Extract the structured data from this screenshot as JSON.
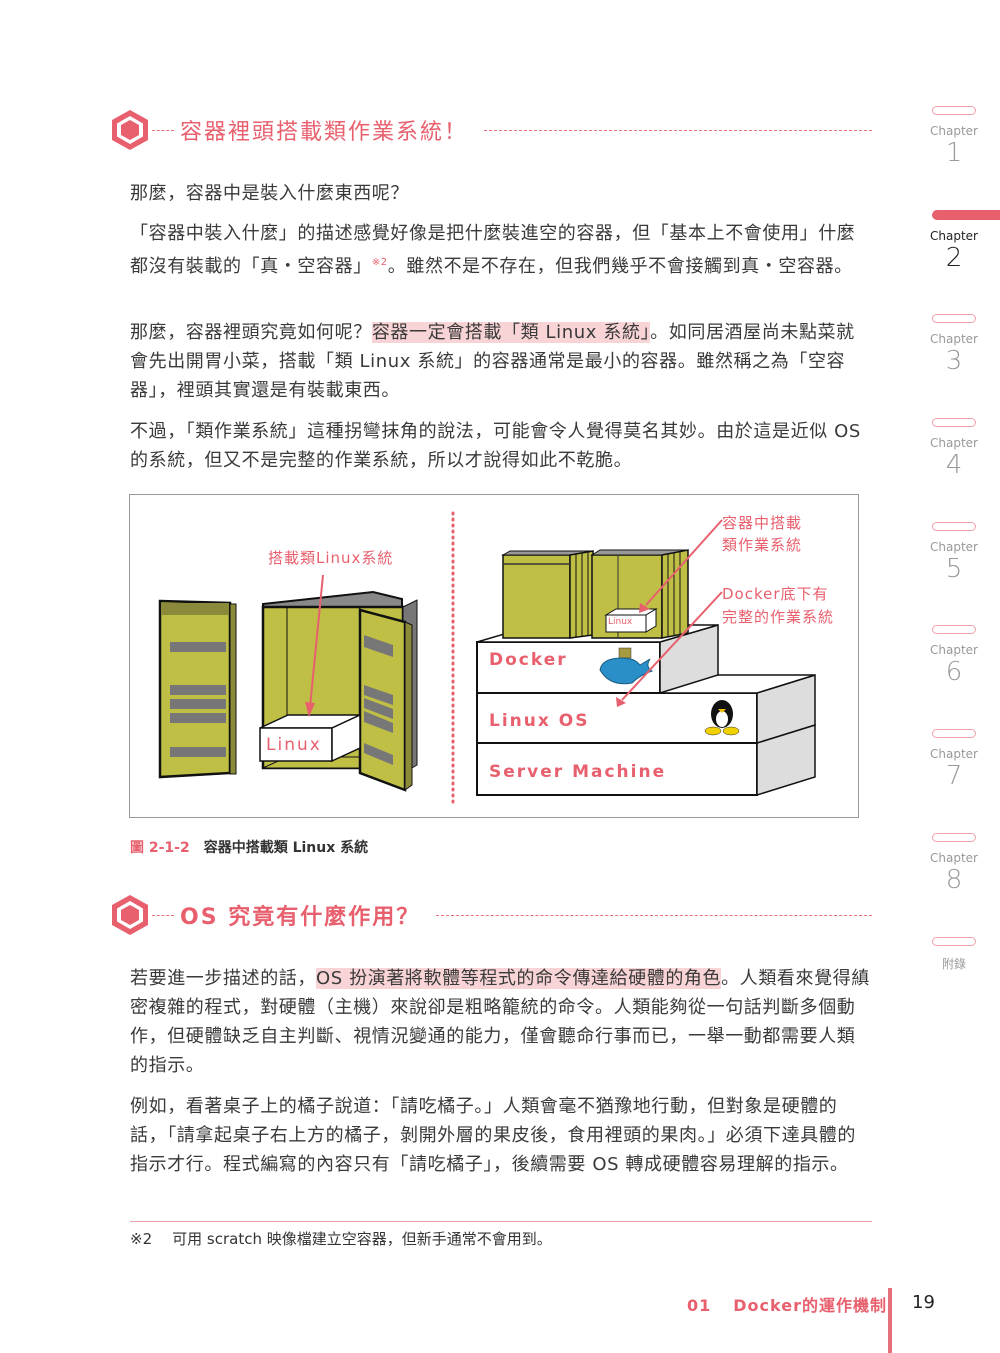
{
  "sections": [
    {
      "title": "容器裡頭搭載類作業系統！"
    },
    {
      "title": "OS 究竟有什麼作用？"
    }
  ],
  "paragraphs": {
    "p1": "那麼，容器中是裝入什麼東西呢？",
    "p2_a": "「容器中裝入什麼」的描述感覺好像是把什麼裝進空的容器，但「基本上不會使用」什麼都沒有裝載的「真・空容器」",
    "p2_sup": "※2",
    "p2_b": "。雖然不是不存在，但我們幾乎不會接觸到真・空容器。",
    "p3_a": "那麼，容器裡頭究竟如何呢？",
    "p3_hl": "容器一定會搭載「類 Linux 系統」",
    "p3_b": "。如同居酒屋尚未點菜就會先出開胃小菜，搭載「類 Linux 系統」的容器通常是最小的容器。雖然稱之為「空容器」，裡頭其實還是有裝載東西。",
    "p4": "不過，「類作業系統」這種拐彎抹角的說法，可能會令人覺得莫名其妙。由於這是近似 OS 的系統，但又不是完整的作業系統，所以才說得如此不乾脆。",
    "p5_a": "若要進一步描述的話，",
    "p5_hl": "OS 扮演著將軟體等程式的命令傳達給硬體的角色",
    "p5_b": "。人類看來覺得縝密複雜的程式，對硬體（主機）來說卻是粗略籠統的命令。人類能夠從一句話判斷多個動作，但硬體缺乏自主判斷、視情況變通的能力，僅會聽命行事而已，一舉一動都需要人類的指示。",
    "p6": "例如，看著桌子上的橘子說道：「請吃橘子。」人類會毫不猶豫地行動，但對象是硬體的話，「請拿起桌子右上方的橘子，剝開外層的果皮後，食用裡頭的果肉。」必須下達具體的指示才行。程式編寫的內容只有「請吃橘子」，後續需要 OS 轉成硬體容易理解的指示。"
  },
  "figure": {
    "left_label": "搭載類Linux系統",
    "left_box": "Linux",
    "right_box": "Linux",
    "label_container_os_1": "容器中搭載",
    "label_container_os_2": "類作業系統",
    "label_full_os_1": "Docker底下有",
    "label_full_os_2": "完整的作業系統",
    "layer_docker": "Docker",
    "layer_linux": "Linux OS",
    "layer_server": "Server Machine",
    "caption_num": "圖 2-1-2",
    "caption_text": "容器中搭載類 Linux 系統"
  },
  "footnote": {
    "mark": "※2",
    "text": "可用 scratch 映像檔建立空容器，但新手通常不會用到。"
  },
  "sidebar": {
    "chapter_label": "Chapter",
    "chapters": [
      "1",
      "2",
      "3",
      "4",
      "5",
      "6",
      "7",
      "8"
    ],
    "active": "2",
    "appendix": "附錄"
  },
  "footer": {
    "num": "01",
    "title": "Docker的運作機制",
    "page": "19"
  },
  "colors": {
    "accent": "#e8606e",
    "highlight": "#f8d4d7",
    "container": "#bfbf46"
  }
}
